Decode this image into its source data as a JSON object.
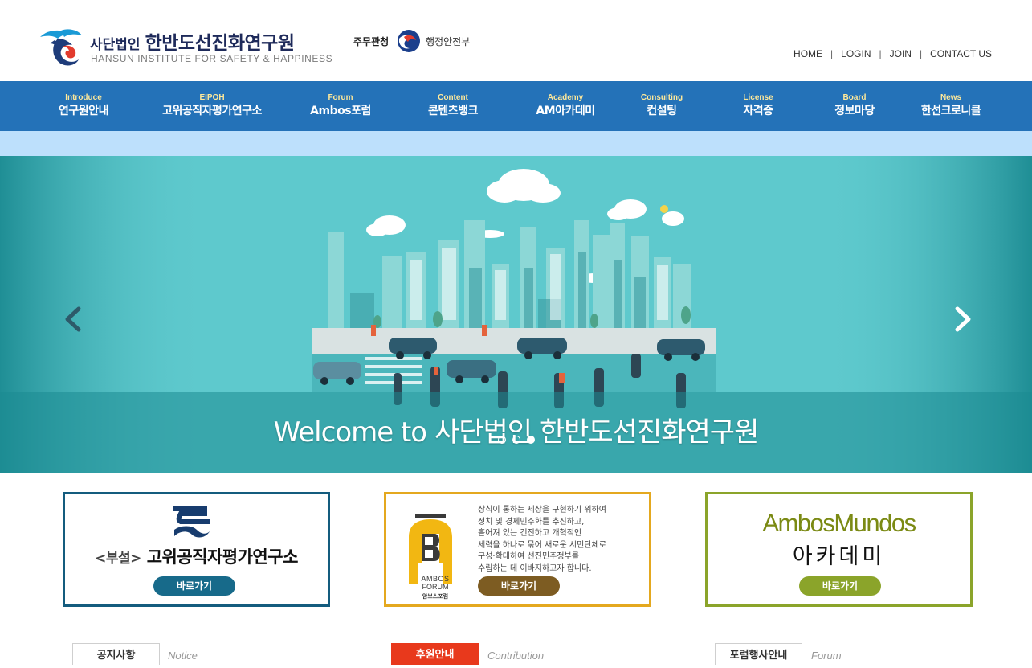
{
  "header": {
    "logo_small": "사단법인",
    "logo_big": "한반도선진화연구원",
    "logo_en": "HANSUN INSTITUTE FOR SAFETY & HAPPINESS",
    "gov_prefix": "주무관청",
    "gov_name": "행정안전부",
    "util_links": [
      "HOME",
      "LOGIN",
      "JOIN",
      "CONTACT US"
    ]
  },
  "nav": [
    {
      "en": "Introduce",
      "ko": "연구원안내"
    },
    {
      "en": "EIPOH",
      "ko": "고위공직자평가연구소"
    },
    {
      "en": "Forum",
      "ko": "Ambos포럼"
    },
    {
      "en": "Content",
      "ko": "콘텐츠뱅크"
    },
    {
      "en": "Academy",
      "ko": "AM아카데미"
    },
    {
      "en": "Consulting",
      "ko": "컨설팅"
    },
    {
      "en": "License",
      "ko": "자격증"
    },
    {
      "en": "Board",
      "ko": "정보마당"
    },
    {
      "en": "News",
      "ko": "한선크로니클"
    }
  ],
  "hero": {
    "caption": "Welcome to 사단법인 한반도선진화연구원",
    "slide_count": 3,
    "active_slide": 3
  },
  "banners": {
    "eipoh": {
      "prefix": "<부설>",
      "title": "고위공직자평가연구소",
      "button": "바로가기"
    },
    "ambos_forum": {
      "logo_en1": "AMBOS",
      "logo_en2": "FORUM",
      "logo_ko": "암보스포럼",
      "text_lines": [
        "상식이 통하는 세상을 구현하기 위하여",
        "정치 및 경제민주화를 추진하고,",
        "흩어져 있는 건전하고 개혁적인",
        "세력을 하나로 묶어 새로운 시민단체로",
        "구성·확대하여 선진민주정부를",
        "수립하는 데 이바지하고자 합니다."
      ],
      "button": "바로가기"
    },
    "academy": {
      "title": "AmbosMundos",
      "subtitle": "아카데미",
      "button": "바로가기"
    }
  },
  "tabs": [
    {
      "label": "공지사항",
      "en": "Notice"
    },
    {
      "label": "후원안내",
      "en": "Contribution"
    },
    {
      "label": "포럼행사안내",
      "en": "Forum"
    }
  ],
  "colors": {
    "nav_bg": "#2472b8",
    "subbar_bg": "#bde0fc",
    "eipoh_border": "#145c7e",
    "ambos_border": "#e4a81f",
    "academy_border": "#8ba42a",
    "contribution_tab": "#e8391c"
  }
}
